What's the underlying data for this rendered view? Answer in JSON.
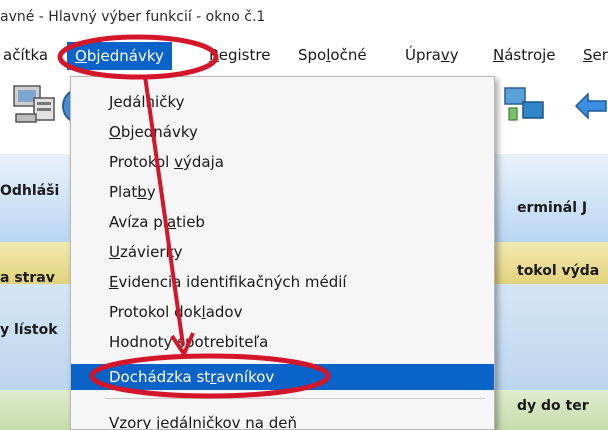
{
  "window": {
    "title": "avné - Hlavný výber funkcií - okno č.1"
  },
  "menubar": {
    "items": [
      {
        "id": "tlacitka",
        "label": "ačítka"
      },
      {
        "id": "objednavky",
        "label": "Objednávky",
        "active": true
      },
      {
        "id": "registre",
        "label": "Registre"
      },
      {
        "id": "spolocne",
        "label": "Spoločné"
      },
      {
        "id": "upravy",
        "label": "Úpravy"
      },
      {
        "id": "nastroje",
        "label": "Nástroje"
      },
      {
        "id": "servis",
        "label": "Ser"
      }
    ]
  },
  "toolbar": {
    "icons": [
      "computer-icon",
      "globe-icon",
      "network-icon",
      "arrow-icon"
    ]
  },
  "background": {
    "left": [
      "Odhláši",
      "a strav",
      "y lístok"
    ],
    "right": [
      "erminál J",
      "tokol výda",
      "dy do ter"
    ]
  },
  "dropdown": {
    "items": [
      {
        "label": "Jedálničky"
      },
      {
        "label": "Objednávky"
      },
      {
        "label": "Protokol výdaja"
      },
      {
        "label": "Platby"
      },
      {
        "label": "Avíza platieb"
      },
      {
        "label": "Uzávierky"
      },
      {
        "label": "Evidencia identifikačných médií"
      },
      {
        "label": "Protokol dokladov"
      },
      {
        "label": "Hodnoty spotrebiteľa"
      },
      {
        "label": "Dochádzka stravníkov",
        "selected": true
      },
      {
        "label": "Vzory jedálničkov na deň"
      }
    ]
  },
  "colors": {
    "highlight": "#0a63c8",
    "annotation": "#d4162a"
  }
}
